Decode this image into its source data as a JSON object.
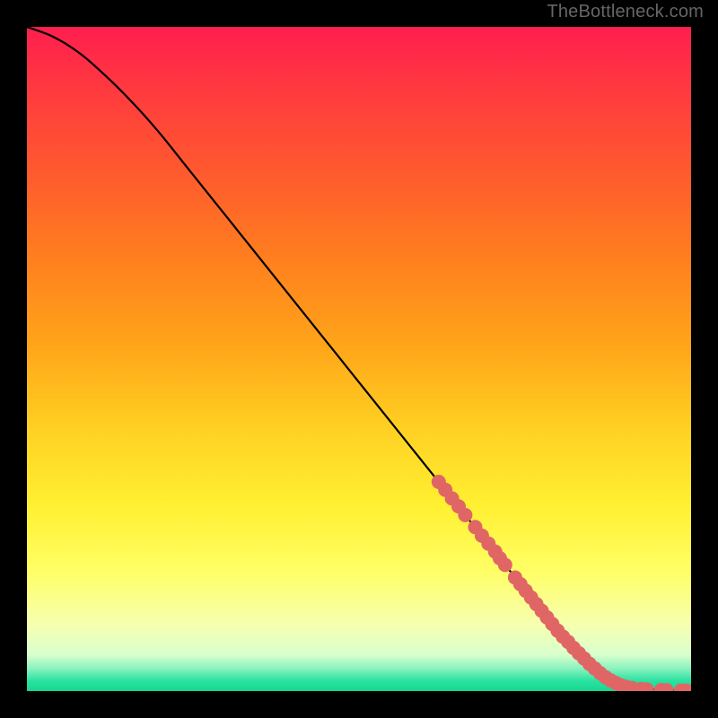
{
  "watermark": "TheBottleneck.com",
  "colors": {
    "page_bg": "#000000",
    "curve": "#000000",
    "marker": "#e06666",
    "gradient_stops": [
      {
        "offset": 0.0,
        "color": "#ff1e4f"
      },
      {
        "offset": 0.1,
        "color": "#ff3b3e"
      },
      {
        "offset": 0.22,
        "color": "#ff5a2e"
      },
      {
        "offset": 0.35,
        "color": "#ff7f1e"
      },
      {
        "offset": 0.48,
        "color": "#ffa519"
      },
      {
        "offset": 0.6,
        "color": "#ffcf22"
      },
      {
        "offset": 0.72,
        "color": "#fff031"
      },
      {
        "offset": 0.82,
        "color": "#ffff66"
      },
      {
        "offset": 0.9,
        "color": "#f6ffb0"
      },
      {
        "offset": 0.945,
        "color": "#d9ffcc"
      },
      {
        "offset": 0.965,
        "color": "#8ef3c0"
      },
      {
        "offset": 0.985,
        "color": "#28e2a0"
      },
      {
        "offset": 1.0,
        "color": "#18d890"
      }
    ]
  },
  "chart_data": {
    "type": "line",
    "title": "",
    "xlabel": "",
    "ylabel": "",
    "xlim": [
      0,
      100
    ],
    "ylim": [
      0,
      100
    ],
    "grid": false,
    "legend": false,
    "series": [
      {
        "name": "curve",
        "x": [
          0,
          4,
          8,
          12,
          16,
          20,
          24,
          28,
          32,
          36,
          40,
          44,
          48,
          52,
          56,
          60,
          64,
          68,
          72,
          76,
          80,
          82,
          84,
          86,
          88,
          90,
          92,
          94,
          96,
          98,
          100
        ],
        "y": [
          100,
          98.5,
          96,
          92.5,
          88.5,
          84,
          79,
          74,
          69,
          64,
          59,
          54,
          49,
          44,
          39,
          34,
          29,
          24,
          19,
          14,
          9,
          7,
          5,
          3.2,
          1.8,
          0.9,
          0.45,
          0.25,
          0.15,
          0.08,
          0.05
        ]
      }
    ],
    "markers": [
      {
        "x": 62,
        "y": 31.5
      },
      {
        "x": 63,
        "y": 30.3
      },
      {
        "x": 64,
        "y": 29.0
      },
      {
        "x": 65,
        "y": 27.8
      },
      {
        "x": 66,
        "y": 26.5
      },
      {
        "x": 67.5,
        "y": 24.7
      },
      {
        "x": 68.5,
        "y": 23.4
      },
      {
        "x": 69.5,
        "y": 22.2
      },
      {
        "x": 70.5,
        "y": 21.0
      },
      {
        "x": 71.2,
        "y": 20.0
      },
      {
        "x": 72,
        "y": 19.0
      },
      {
        "x": 73.5,
        "y": 17.1
      },
      {
        "x": 74.3,
        "y": 16.1
      },
      {
        "x": 75.1,
        "y": 15.1
      },
      {
        "x": 75.9,
        "y": 14.1
      },
      {
        "x": 76.7,
        "y": 13.1
      },
      {
        "x": 77.5,
        "y": 12.1
      },
      {
        "x": 78.3,
        "y": 11.1
      },
      {
        "x": 79.1,
        "y": 10.1
      },
      {
        "x": 79.9,
        "y": 9.1
      },
      {
        "x": 80.7,
        "y": 8.2
      },
      {
        "x": 81.5,
        "y": 7.4
      },
      {
        "x": 82.3,
        "y": 6.5
      },
      {
        "x": 83.1,
        "y": 5.7
      },
      {
        "x": 83.9,
        "y": 4.9
      },
      {
        "x": 84.7,
        "y": 4.1
      },
      {
        "x": 85.5,
        "y": 3.4
      },
      {
        "x": 86.3,
        "y": 2.7
      },
      {
        "x": 87.1,
        "y": 2.1
      },
      {
        "x": 87.9,
        "y": 1.6
      },
      {
        "x": 88.7,
        "y": 1.2
      },
      {
        "x": 89.5,
        "y": 0.85
      },
      {
        "x": 90.3,
        "y": 0.6
      },
      {
        "x": 91.1,
        "y": 0.45
      },
      {
        "x": 92.5,
        "y": 0.3
      },
      {
        "x": 93.3,
        "y": 0.25
      },
      {
        "x": 95.5,
        "y": 0.15
      },
      {
        "x": 96.3,
        "y": 0.12
      },
      {
        "x": 98.5,
        "y": 0.08
      },
      {
        "x": 99.3,
        "y": 0.06
      }
    ]
  }
}
